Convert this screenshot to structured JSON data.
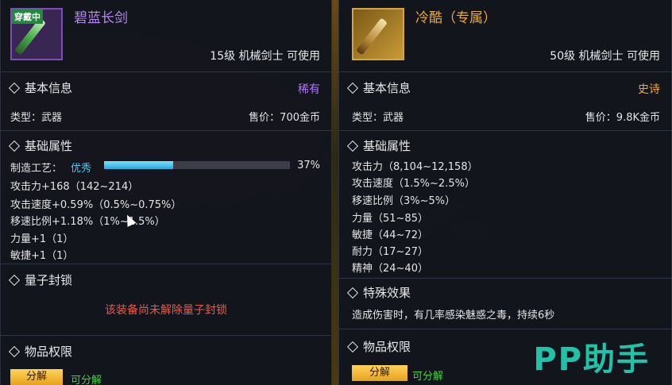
{
  "left": {
    "badge": "穿戴中",
    "name": "碧蓝长剑",
    "requirement": "15级 机械剑士 可使用",
    "basic_info": {
      "title": "基本信息",
      "rarity": "稀有",
      "rarity_color": "#b074ff",
      "type": "类型：武器",
      "price": "售价：700金币"
    },
    "attributes": {
      "title": "基础属性",
      "craft_label": "制造工艺：",
      "craft_quality": "优秀",
      "craft_percent_text": "37%",
      "craft_percent": 37,
      "lines": [
        "攻击力+168（142~214）",
        "攻击速度+0.59%（0.5%~0.75%）",
        "移速比例+1.18%（1%~1.5%）",
        "力量+1（1）",
        "敏捷+1（1）"
      ]
    },
    "quantum": {
      "title": "量子封锁",
      "warning": "该装备尚未解除量子封锁"
    },
    "permission": {
      "title": "物品权限",
      "button": "分解",
      "status": "可分解"
    }
  },
  "right": {
    "name": "冷酷（专属）",
    "requirement": "50级 机械剑士 可使用",
    "basic_info": {
      "title": "基本信息",
      "rarity": "史诗",
      "rarity_color": "#f0a830",
      "type": "类型：武器",
      "price": "售价：9.8K金币"
    },
    "attributes": {
      "title": "基础属性",
      "lines": [
        "攻击力（8,104~12,158）",
        "攻击速度（1.5%~2.5%）",
        "移速比例（3%~5%）",
        "力量（51~85）",
        "敏捷（44~72）",
        "耐力（17~27）",
        "精神（24~40）"
      ]
    },
    "special": {
      "title": "特殊效果",
      "text": "造成伤害时，有几率感染魅惑之毒，持续6秒"
    },
    "permission": {
      "title": "物品权限",
      "button": "分解",
      "status": "可分解"
    }
  },
  "watermark": "PP助手"
}
